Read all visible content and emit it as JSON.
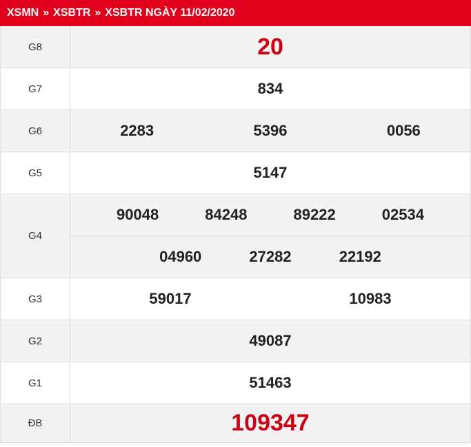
{
  "breadcrumb": {
    "items": [
      "XSMN",
      "XSBTR",
      "XSBTR NGÀY 11/02/2020"
    ],
    "separator": "»"
  },
  "colors": {
    "header_bg": "#e0001b",
    "highlight_number": "#cc0011",
    "shaded_row": "#f2f2f2"
  },
  "prizes": {
    "g8": {
      "label": "G8",
      "numbers": [
        "20"
      ]
    },
    "g7": {
      "label": "G7",
      "numbers": [
        "834"
      ]
    },
    "g6": {
      "label": "G6",
      "numbers": [
        "2283",
        "5396",
        "0056"
      ]
    },
    "g5": {
      "label": "G5",
      "numbers": [
        "5147"
      ]
    },
    "g4": {
      "label": "G4",
      "numbers": [
        "90048",
        "84248",
        "89222",
        "02534",
        "04960",
        "27282",
        "22192"
      ]
    },
    "g3": {
      "label": "G3",
      "numbers": [
        "59017",
        "10983"
      ]
    },
    "g2": {
      "label": "G2",
      "numbers": [
        "49087"
      ]
    },
    "g1": {
      "label": "G1",
      "numbers": [
        "51463"
      ]
    },
    "db": {
      "label": "ĐB",
      "numbers": [
        "109347"
      ]
    }
  }
}
